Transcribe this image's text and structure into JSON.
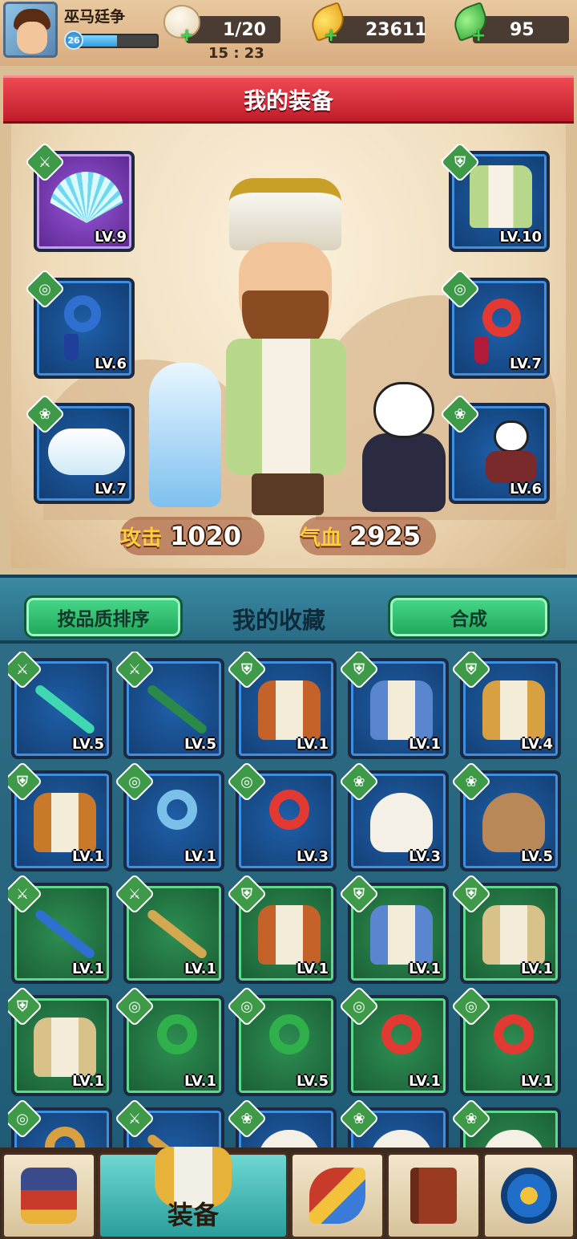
{
  "player": {
    "name": "巫马廷争",
    "level": "26",
    "xp_progress": 0.5
  },
  "resources": {
    "stamina": {
      "icon": "steamed-bun-icon",
      "value": "1/20"
    },
    "gold": {
      "icon": "gold-leaf-icon",
      "value": "23611"
    },
    "jade": {
      "icon": "green-leaf-icon",
      "value": "95"
    },
    "timer": "15 : 23"
  },
  "equip": {
    "title": "我的装备",
    "left_slots": [
      {
        "name": "fan",
        "level": "LV.9",
        "rarity": "purple",
        "type": "weapon"
      },
      {
        "name": "blue-pendant",
        "level": "LV.6",
        "rarity": "blue",
        "type": "accessory"
      },
      {
        "name": "ferret-pet",
        "level": "LV.7",
        "rarity": "blue",
        "type": "pet"
      }
    ],
    "right_slots": [
      {
        "name": "green-robe",
        "level": "LV.10",
        "rarity": "blue",
        "type": "armor"
      },
      {
        "name": "red-pendant",
        "level": "LV.7",
        "rarity": "blue",
        "type": "accessory"
      },
      {
        "name": "panda-pet",
        "level": "LV.6",
        "rarity": "blue",
        "type": "pet"
      }
    ],
    "stats": {
      "attack_label": "攻击",
      "attack_value": "1020",
      "hp_label": "气血",
      "hp_value": "2925"
    }
  },
  "collection": {
    "sort_button": "按品质排序",
    "title": "我的收藏",
    "craft_button": "合成",
    "items": [
      {
        "level": "LV.5",
        "rarity": "blue",
        "type": "weapon",
        "color": "#3fd8b0"
      },
      {
        "level": "LV.5",
        "rarity": "blue",
        "type": "weapon",
        "color": "#2a8a4a"
      },
      {
        "level": "LV.1",
        "rarity": "blue",
        "type": "armor",
        "color": "#c5622a"
      },
      {
        "level": "LV.1",
        "rarity": "blue",
        "type": "armor",
        "color": "#5a86d0"
      },
      {
        "level": "LV.4",
        "rarity": "blue",
        "type": "armor",
        "color": "#d8a040"
      },
      {
        "level": "LV.1",
        "rarity": "blue",
        "type": "armor",
        "color": "#c87a2a"
      },
      {
        "level": "LV.1",
        "rarity": "blue",
        "type": "accessory",
        "color": "#7ac0e8"
      },
      {
        "level": "LV.3",
        "rarity": "blue",
        "type": "accessory",
        "color": "#e23a32"
      },
      {
        "level": "LV.3",
        "rarity": "blue",
        "type": "pet",
        "color": "#f4f0e6"
      },
      {
        "level": "LV.5",
        "rarity": "blue",
        "type": "pet",
        "color": "#b88858"
      },
      {
        "level": "LV.1",
        "rarity": "green",
        "type": "weapon",
        "color": "#2f6fd0"
      },
      {
        "level": "LV.1",
        "rarity": "green",
        "type": "weapon",
        "color": "#d4a850"
      },
      {
        "level": "LV.1",
        "rarity": "green",
        "type": "armor",
        "color": "#c5622a"
      },
      {
        "level": "LV.1",
        "rarity": "green",
        "type": "armor",
        "color": "#5a86d0"
      },
      {
        "level": "LV.1",
        "rarity": "green",
        "type": "armor",
        "color": "#d8c28a"
      },
      {
        "level": "LV.1",
        "rarity": "green",
        "type": "armor",
        "color": "#d8c28a"
      },
      {
        "level": "LV.1",
        "rarity": "green",
        "type": "accessory",
        "color": "#2fb04a"
      },
      {
        "level": "LV.5",
        "rarity": "green",
        "type": "accessory",
        "color": "#2fb04a"
      },
      {
        "level": "LV.1",
        "rarity": "green",
        "type": "accessory",
        "color": "#e23a32"
      },
      {
        "level": "LV.1",
        "rarity": "green",
        "type": "accessory",
        "color": "#e23a32"
      },
      {
        "level": "",
        "rarity": "blue",
        "type": "accessory",
        "color": "#d8a040"
      },
      {
        "level": "",
        "rarity": "blue",
        "type": "weapon",
        "color": "#d8a040"
      },
      {
        "level": "",
        "rarity": "blue",
        "type": "pet",
        "color": "#f4f0e6"
      },
      {
        "level": "",
        "rarity": "blue",
        "type": "pet",
        "color": "#f4f0e6"
      },
      {
        "level": "",
        "rarity": "green",
        "type": "pet",
        "color": "#f4f0e6"
      }
    ]
  },
  "nav": [
    {
      "name": "shop",
      "icon": "treasure-house-icon",
      "label": ""
    },
    {
      "name": "equipment",
      "icon": "armor-icon",
      "label": "装备",
      "active": true
    },
    {
      "name": "skills",
      "icon": "flaming-sword-icon",
      "label": ""
    },
    {
      "name": "codex",
      "icon": "book-icon",
      "label": ""
    },
    {
      "name": "settings",
      "icon": "gear-icon",
      "label": ""
    }
  ],
  "type_icons": {
    "weapon": "⚔",
    "armor": "⛨",
    "accessory": "◎",
    "pet": "❀"
  }
}
